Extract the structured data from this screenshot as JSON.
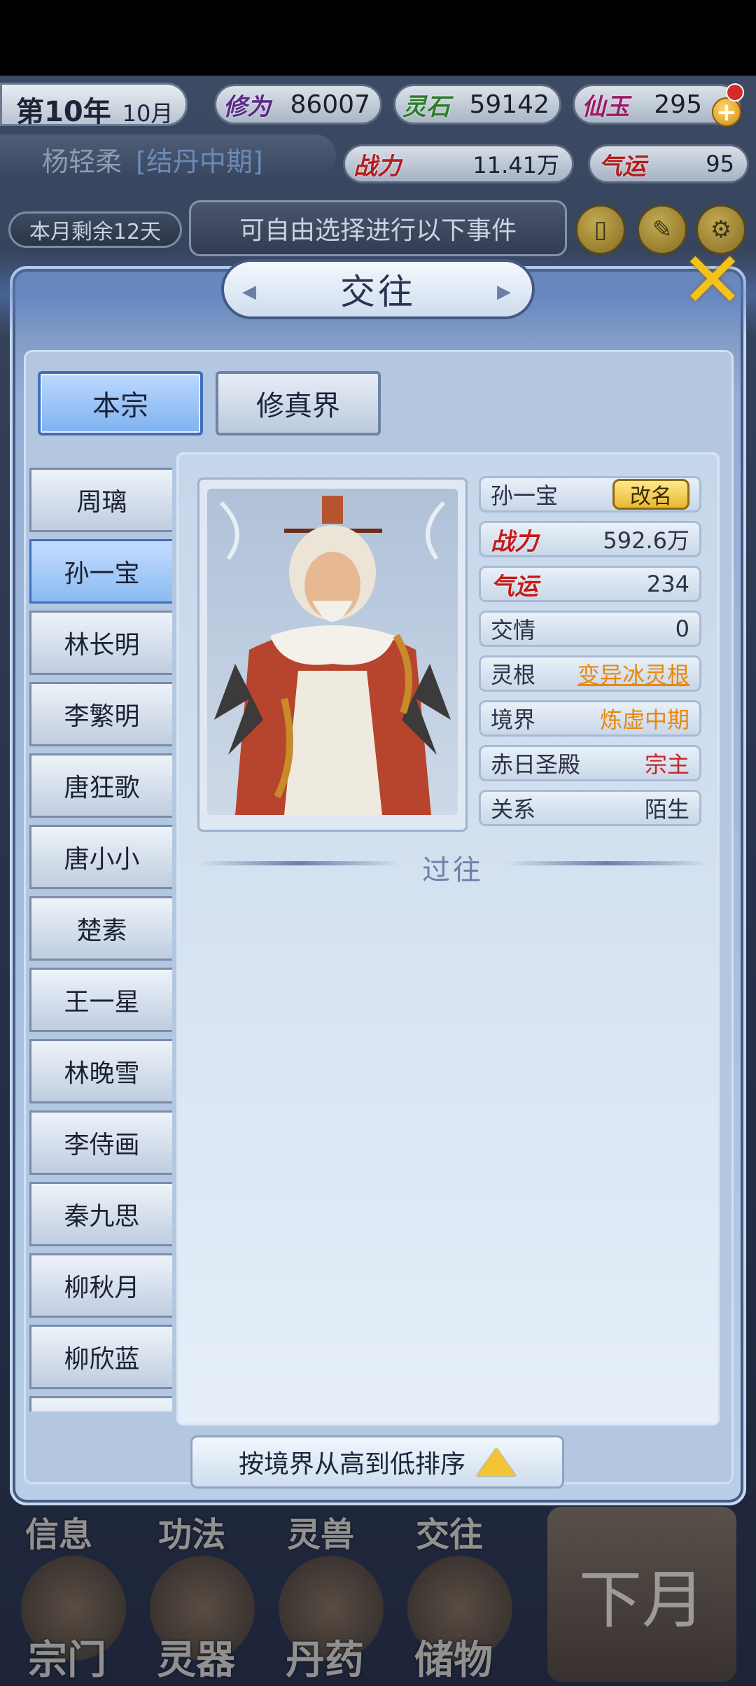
{
  "top": {
    "year": "第10年",
    "month": "10月",
    "resources": [
      {
        "label": "修为",
        "value": "86007"
      },
      {
        "label": "灵石",
        "value": "59142"
      },
      {
        "label": "仙玉",
        "value": "295"
      }
    ],
    "player_name": "杨轻柔",
    "player_realm": "[结丹中期]",
    "combat_label": "战力",
    "combat_value": "11.41万",
    "luck_label": "气运",
    "luck_value": "95",
    "remaining_days": "本月剩余12天",
    "event_hint": "可自由选择进行以下事件",
    "plus": "+"
  },
  "modal": {
    "title": "交往",
    "close": "✕",
    "tabs": [
      "本宗",
      "修真界"
    ],
    "list": [
      "周璃",
      "孙一宝",
      "林长明",
      "李繁明",
      "唐狂歌",
      "唐小小",
      "楚素",
      "王一星",
      "林晚雪",
      "李侍画",
      "秦九思",
      "柳秋月",
      "柳欣蓝"
    ],
    "selected_index": 1
  },
  "detail": {
    "name": "孙一宝",
    "rename": "改名",
    "combat_label": "战力",
    "combat_value": "592.6万",
    "luck_label": "气运",
    "luck_value": "234",
    "rows": [
      {
        "label": "交情",
        "value": "0"
      },
      {
        "label": "灵根",
        "value": "变异冰灵根"
      },
      {
        "label": "境界",
        "value": "炼虚中期"
      },
      {
        "label": "赤日圣殿",
        "value": "宗主"
      },
      {
        "label": "关系",
        "value": "陌生"
      }
    ],
    "past_title": "过往"
  },
  "sort_label": "按境界从高到低排序",
  "bottom_nav": {
    "row1": [
      "信息",
      "功法",
      "灵兽",
      "交往"
    ],
    "row2": [
      "宗门",
      "灵器",
      "丹药",
      "储物"
    ],
    "next_month": "下月"
  },
  "colors": {
    "accent_orange": "#e8880e",
    "status_red": "#c72626",
    "gold": "#f3c318"
  }
}
